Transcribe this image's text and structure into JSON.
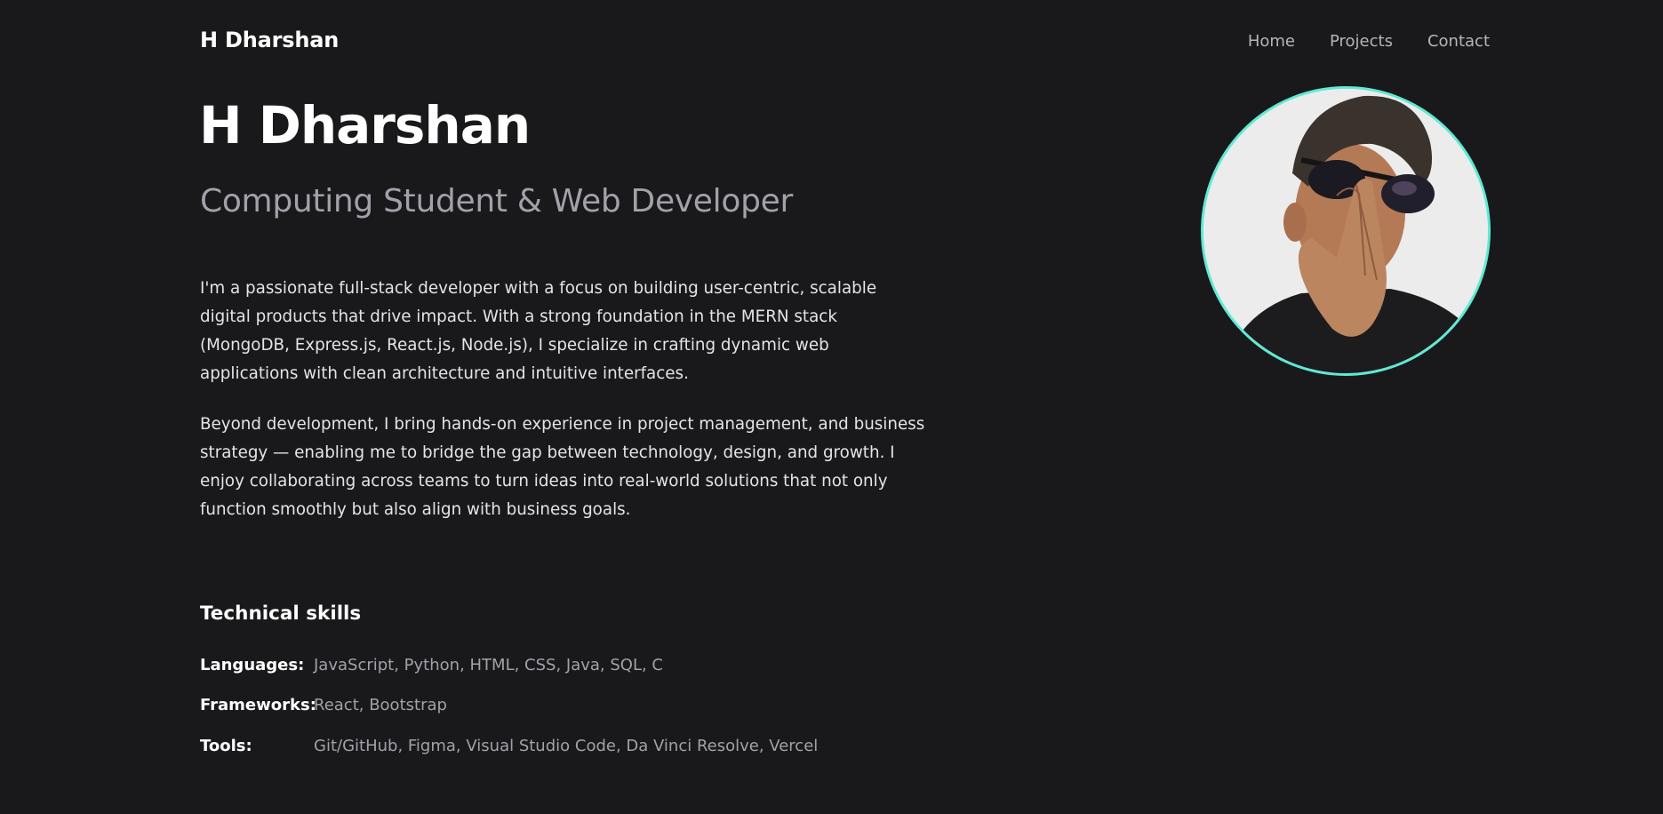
{
  "header": {
    "brand": "H Dharshan",
    "nav": [
      "Home",
      "Projects",
      "Contact"
    ]
  },
  "hero": {
    "name": "H Dharshan",
    "role": "Computing Student & Web Developer",
    "bio": [
      "I'm a passionate full-stack developer with a focus on building user-centric, scalable digital products that drive impact. With a strong foundation in the MERN stack (MongoDB, Express.js, React.js, Node.js), I specialize in crafting dynamic web applications with clean architecture and intuitive interfaces.",
      "Beyond development, I bring hands-on experience in project management, and business strategy — enabling me to bridge the gap between technology, design, and growth. I enjoy collaborating across teams to turn ideas into real-world solutions that not only function smoothly but also align with business goals."
    ]
  },
  "avatar": {
    "icon": "profile-photo",
    "ring_color": "#5eead4"
  },
  "skills": {
    "title": "Technical skills",
    "rows": [
      {
        "label": "Languages:",
        "value": "JavaScript, Python, HTML, CSS, Java, SQL, C"
      },
      {
        "label": "Frameworks:",
        "value": "React, Bootstrap"
      },
      {
        "label": "Tools:",
        "value": "Git/GitHub, Figma, Visual Studio Code, Da Vinci Resolve, Vercel"
      }
    ]
  },
  "colors": {
    "background": "#19191b",
    "accent": "#5eead4",
    "muted": "#a1a1aa"
  }
}
